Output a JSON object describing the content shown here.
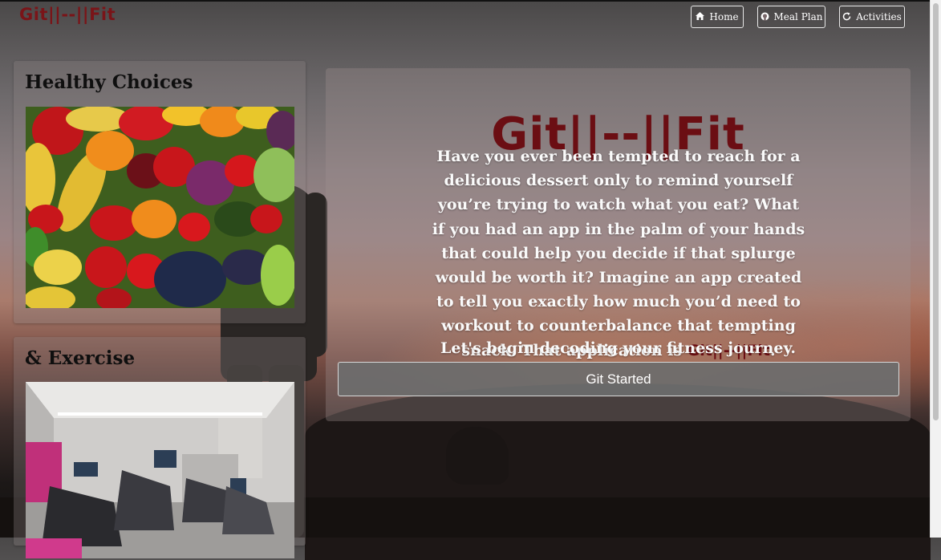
{
  "brand": {
    "name": "Git||--||Fit"
  },
  "nav": {
    "items": [
      {
        "label": "Home",
        "icon": "home-icon"
      },
      {
        "label": "Meal Plan",
        "icon": "github-icon"
      },
      {
        "label": "Activities",
        "icon": "refresh-icon"
      }
    ]
  },
  "cards": {
    "healthy": {
      "title": "Healthy Choices",
      "image": "vegetables-image"
    },
    "exercise": {
      "title": "& Exercise",
      "image": "gym-image"
    }
  },
  "hero": {
    "title": "Git||--||Fit",
    "paragraph": "Have you ever been tempted to reach for a delicious dessert only to remind yourself you’re trying to watch what you eat? What if you had an app in the palm of your hands that could help you decide if that splurge would be worth it? Imagine an app created to tell you exactly how much you’d need to workout to counterbalance that tempting snack.",
    "brand_sentence_prefix": "That application is ",
    "brand_inline": "Git||--||Fit",
    "brand_sentence_suffix": ".",
    "tagline": "Let's begin decoding your fitness journey.",
    "cta_label": "Git Started"
  },
  "colors": {
    "brand": "#6b0e13",
    "text": "#fafafa",
    "button_bg": "#6c6c6c"
  }
}
